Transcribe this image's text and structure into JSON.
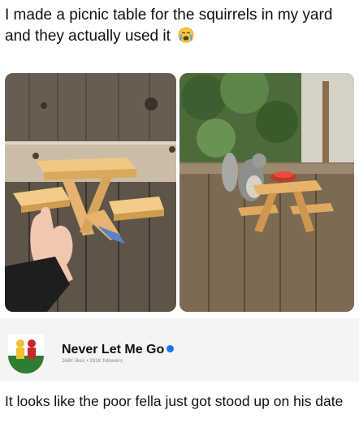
{
  "post": {
    "text": "I made a picnic table for the squirrels in my yard and they actually used it",
    "emoji": "crying-face-emoji"
  },
  "images": [
    {
      "name": "hand-holding-picnic-table-photo",
      "description_icon": "photo"
    },
    {
      "name": "squirrel-on-picnic-table-photo",
      "description_icon": "photo"
    }
  ],
  "page": {
    "name": "Never Let Me Go",
    "stats": "268K likes • 281K followers",
    "verified": true
  },
  "comment": {
    "text": "It looks like the poor fella just got stood up on his date"
  },
  "colors": {
    "card_bg": "#f4f4f4",
    "verified": "#1877f2"
  }
}
